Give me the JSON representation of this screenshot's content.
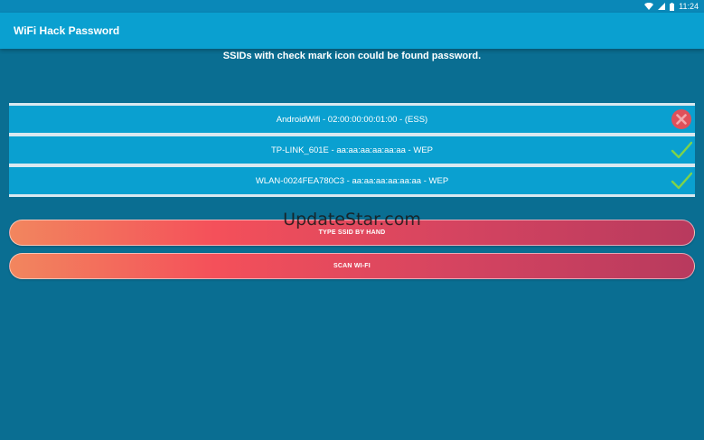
{
  "status_bar": {
    "time": "11:24",
    "icons": [
      "wifi-icon",
      "signal-icon",
      "battery-icon"
    ]
  },
  "app_bar": {
    "title": "WiFi Hack Password"
  },
  "instruction": "SSIDs with check mark icon could be found password.",
  "ssids": [
    {
      "label": "AndroidWifi - 02:00:00:00:01:00 - (ESS)",
      "status": "failed",
      "icon": "cross-circle-icon"
    },
    {
      "label": "TP-LINK_601E - aa:aa:aa:aa:aa:aa - WEP",
      "status": "found",
      "icon": "check-icon"
    },
    {
      "label": "WLAN-0024FEA780C3 - aa:aa:aa:aa:aa:aa - WEP",
      "status": "found",
      "icon": "check-icon"
    }
  ],
  "buttons": {
    "type_ssid": "TYPE SSID BY HAND",
    "scan_wifi": "SCAN WI-FI"
  },
  "watermark": "UpdateStar.com",
  "colors": {
    "background": "#0a6e92",
    "app_bar": "#0aa0d0",
    "row": "#0aa0d0",
    "check": "#7ed34a",
    "cross": "#e0505a"
  }
}
